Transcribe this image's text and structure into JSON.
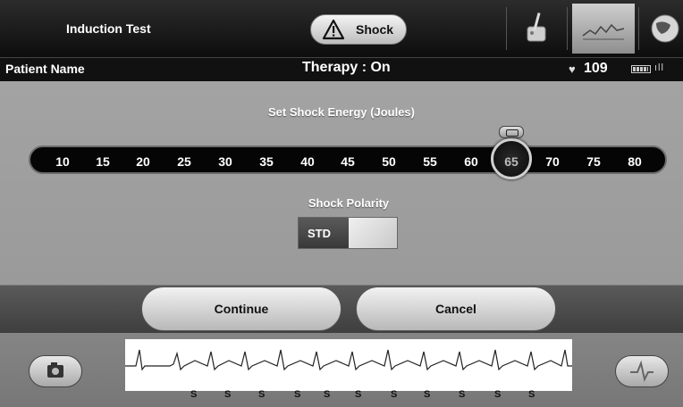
{
  "header": {
    "title": "Induction Test",
    "shock_label": "Shock"
  },
  "status": {
    "patient_label": "Patient Name",
    "therapy": "Therapy : On",
    "heart_rate": "109"
  },
  "energy": {
    "title": "Set Shock Energy (Joules)",
    "values": [
      "10",
      "15",
      "20",
      "25",
      "30",
      "35",
      "40",
      "45",
      "50",
      "55",
      "60",
      "65",
      "70",
      "75",
      "80"
    ],
    "selected": "65"
  },
  "polarity": {
    "title": "Shock Polarity",
    "value": "STD"
  },
  "buttons": {
    "continue": "Continue",
    "cancel": "Cancel"
  },
  "ecg": {
    "marker": "S"
  },
  "colors": {
    "background": "#9a9a9a",
    "topbar": "#111111",
    "slider_track": "#050505"
  }
}
